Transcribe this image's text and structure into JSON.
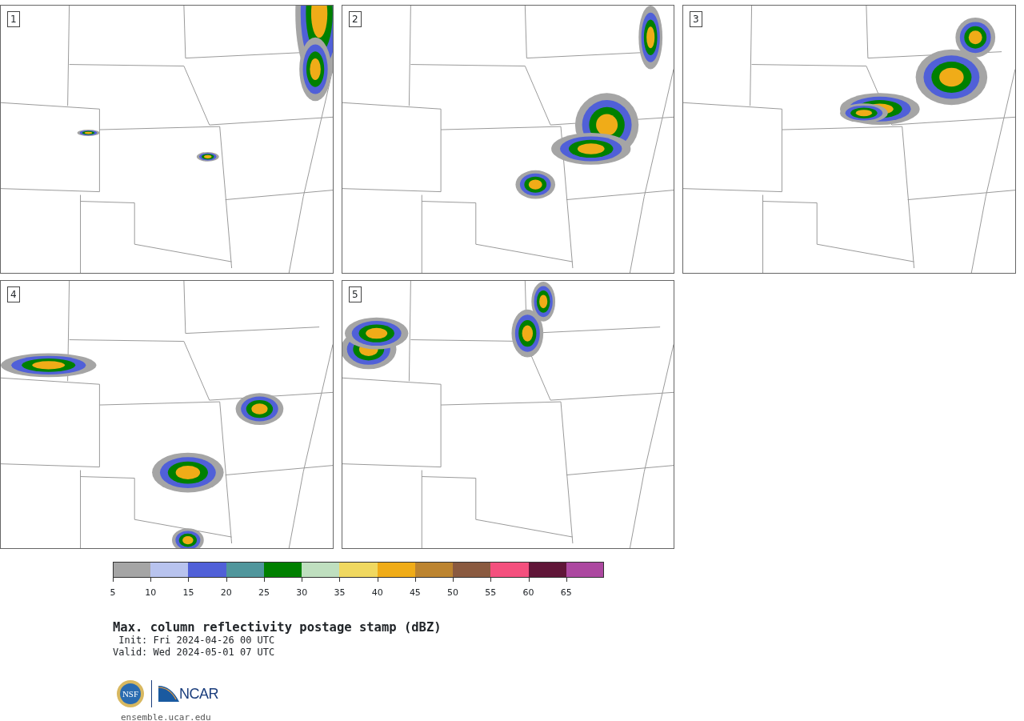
{
  "panels": [
    {
      "label": "1"
    },
    {
      "label": "2"
    },
    {
      "label": "3"
    },
    {
      "label": "4"
    },
    {
      "label": "5"
    }
  ],
  "colorbar": {
    "bins": [
      {
        "color": "#a5a5a5"
      },
      {
        "color": "#b8c3ee"
      },
      {
        "color": "#5060d8"
      },
      {
        "color": "#50969c"
      },
      {
        "color": "#008000"
      },
      {
        "color": "#bfdfbf"
      },
      {
        "color": "#f0d860"
      },
      {
        "color": "#f0ac18"
      },
      {
        "color": "#bc8430"
      },
      {
        "color": "#8a5a40"
      },
      {
        "color": "#f4507e"
      },
      {
        "color": "#601638"
      },
      {
        "color": "#ac48a0"
      }
    ],
    "ticks": [
      "5",
      "10",
      "15",
      "20",
      "25",
      "30",
      "35",
      "40",
      "45",
      "50",
      "55",
      "60",
      "65"
    ]
  },
  "title": "Max. column reflectivity postage stamp (dBZ)",
  "init": " Init: Fri 2024-04-26 00 UTC",
  "valid": "Valid: Wed 2024-05-01 07 UTC",
  "logos": {
    "nsf": "NSF",
    "ncar": "NCAR"
  },
  "site": "ensemble.ucar.edu"
}
